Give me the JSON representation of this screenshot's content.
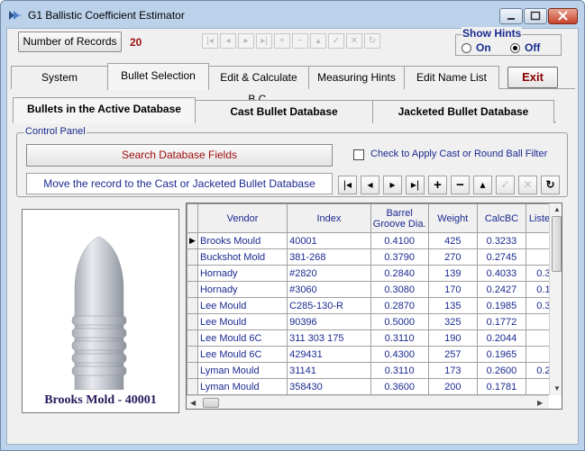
{
  "window": {
    "title": "G1 Ballistic Coefficient Estimator"
  },
  "toolbar": {
    "records_label": "Number of Records",
    "records_count": "20"
  },
  "hints": {
    "title": "Show Hints",
    "on_label": "On",
    "off_label": "Off",
    "selected": "Off"
  },
  "main_tabs": [
    {
      "label": "System"
    },
    {
      "label": "Bullet Selection"
    },
    {
      "label": "Edit & Calculate B.C."
    },
    {
      "label": "Measuring Hints"
    },
    {
      "label": "Edit Name List"
    }
  ],
  "exit_label": "Exit",
  "sub_tabs": [
    {
      "label": "Bullets in the Active Database"
    },
    {
      "label": "Cast Bullet Database"
    },
    {
      "label": "Jacketed Bullet Database"
    }
  ],
  "control_panel": {
    "title": "Control Panel",
    "search_label": "Search Database Fields",
    "move_label": "Move the record to the Cast or Jacketed Bullet Database",
    "filter_label": "Check to Apply Cast or Round Ball Filter",
    "filter_checked": false
  },
  "image_caption": "Brooks Mold - 40001",
  "table": {
    "columns": [
      "Vendor",
      "Index",
      "Barrel\nGroove Dia.",
      "Weight",
      "CalcBC",
      "Liste"
    ],
    "rows": [
      [
        "Brooks Mould",
        "40001",
        "0.4100",
        "425",
        "0.3233",
        ""
      ],
      [
        "Buckshot Mold",
        "381-268",
        "0.3790",
        "270",
        "0.2745",
        ""
      ],
      [
        "Hornady",
        "#2820",
        "0.2840",
        "139",
        "0.4033",
        "0.3"
      ],
      [
        "Hornady",
        "#3060",
        "0.3080",
        "170",
        "0.2427",
        "0.1"
      ],
      [
        "Lee Mould",
        "C285-130-R",
        "0.2870",
        "135",
        "0.1985",
        "0.3"
      ],
      [
        "Lee Mould",
        "90396",
        "0.5000",
        "325",
        "0.1772",
        ""
      ],
      [
        "Lee Mould 6C",
        "311 303 175",
        "0.3110",
        "190",
        "0.2044",
        ""
      ],
      [
        "Lee Mould 6C",
        "429431",
        "0.4300",
        "257",
        "0.1965",
        ""
      ],
      [
        "Lyman Mould",
        "31141",
        "0.3110",
        "173",
        "0.2600",
        "0.2"
      ],
      [
        "Lyman Mould",
        "358430",
        "0.3600",
        "200",
        "0.1781",
        ""
      ]
    ]
  },
  "colors": {
    "window_frame": "#bcd2ea",
    "label_blue": "#1a2a90",
    "accent_red": "#a01010"
  }
}
